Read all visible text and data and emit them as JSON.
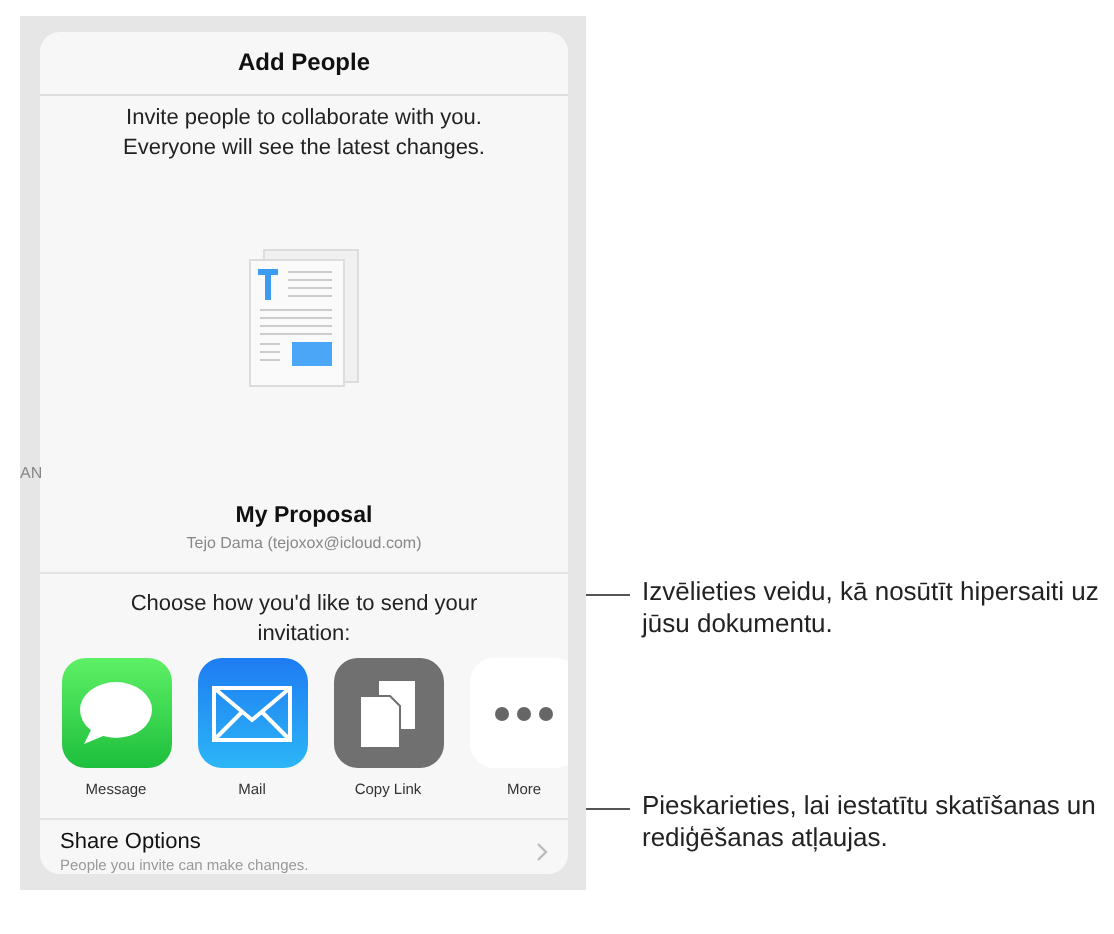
{
  "background_fragment": "AN",
  "sheet": {
    "title": "Add People",
    "intro": [
      "Invite people to collaborate with you.",
      "Everyone will see the latest changes."
    ],
    "document": {
      "name": "My Proposal",
      "owner": "Tejo Dama (tejoxox@icloud.com)"
    },
    "prompt": [
      "Choose how you'd like to send your",
      "invitation:"
    ],
    "share_targets": [
      {
        "kind": "message",
        "label": "Message"
      },
      {
        "kind": "mail",
        "label": "Mail"
      },
      {
        "kind": "copy",
        "label": "Copy Link"
      },
      {
        "kind": "more",
        "label": "More"
      }
    ],
    "share_options": {
      "title": "Share Options",
      "subtitle": "People you invite can make changes."
    }
  },
  "annotations": [
    {
      "text": "Izvēlieties veidu, kā nosūtīt hipersaiti uz jūsu dokumentu."
    },
    {
      "text": "Pieskarieties, lai iestatītu skatīšanas un rediģēšanas atļaujas."
    }
  ]
}
